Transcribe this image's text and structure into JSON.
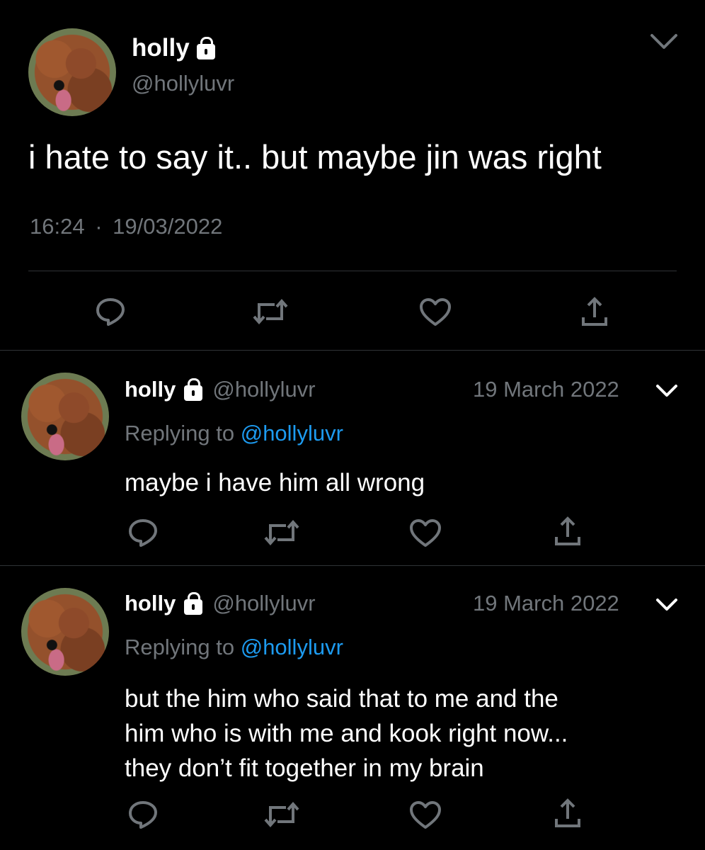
{
  "main_tweet": {
    "display_name": "holly",
    "handle": "@hollyluvr",
    "text": "i hate to say it.. but maybe jin was right",
    "time": "16:24",
    "separator": "·",
    "date": "19/03/2022"
  },
  "replies": [
    {
      "display_name": "holly",
      "handle": "@hollyluvr",
      "date": "19 March 2022",
      "replying_prefix": "Replying to",
      "replying_to": "@hollyluvr",
      "text": "maybe i have him all wrong"
    },
    {
      "display_name": "holly",
      "handle": "@hollyluvr",
      "date": "19 March 2022",
      "replying_prefix": "Replying to",
      "replying_to": "@hollyluvr",
      "text_lines": [
        "but the him who said that to me and the",
        "him who is with me and kook right now...",
        "they don’t fit together in my brain"
      ]
    }
  ],
  "icons": [
    "reply-icon",
    "retweet-icon",
    "like-icon",
    "share-icon",
    "lock-icon",
    "chevron-down-icon"
  ],
  "colors": {
    "background": "#000000",
    "text": "#ffffff",
    "muted": "#71767b",
    "link": "#1d9bf0",
    "divider": "#2f3336"
  }
}
